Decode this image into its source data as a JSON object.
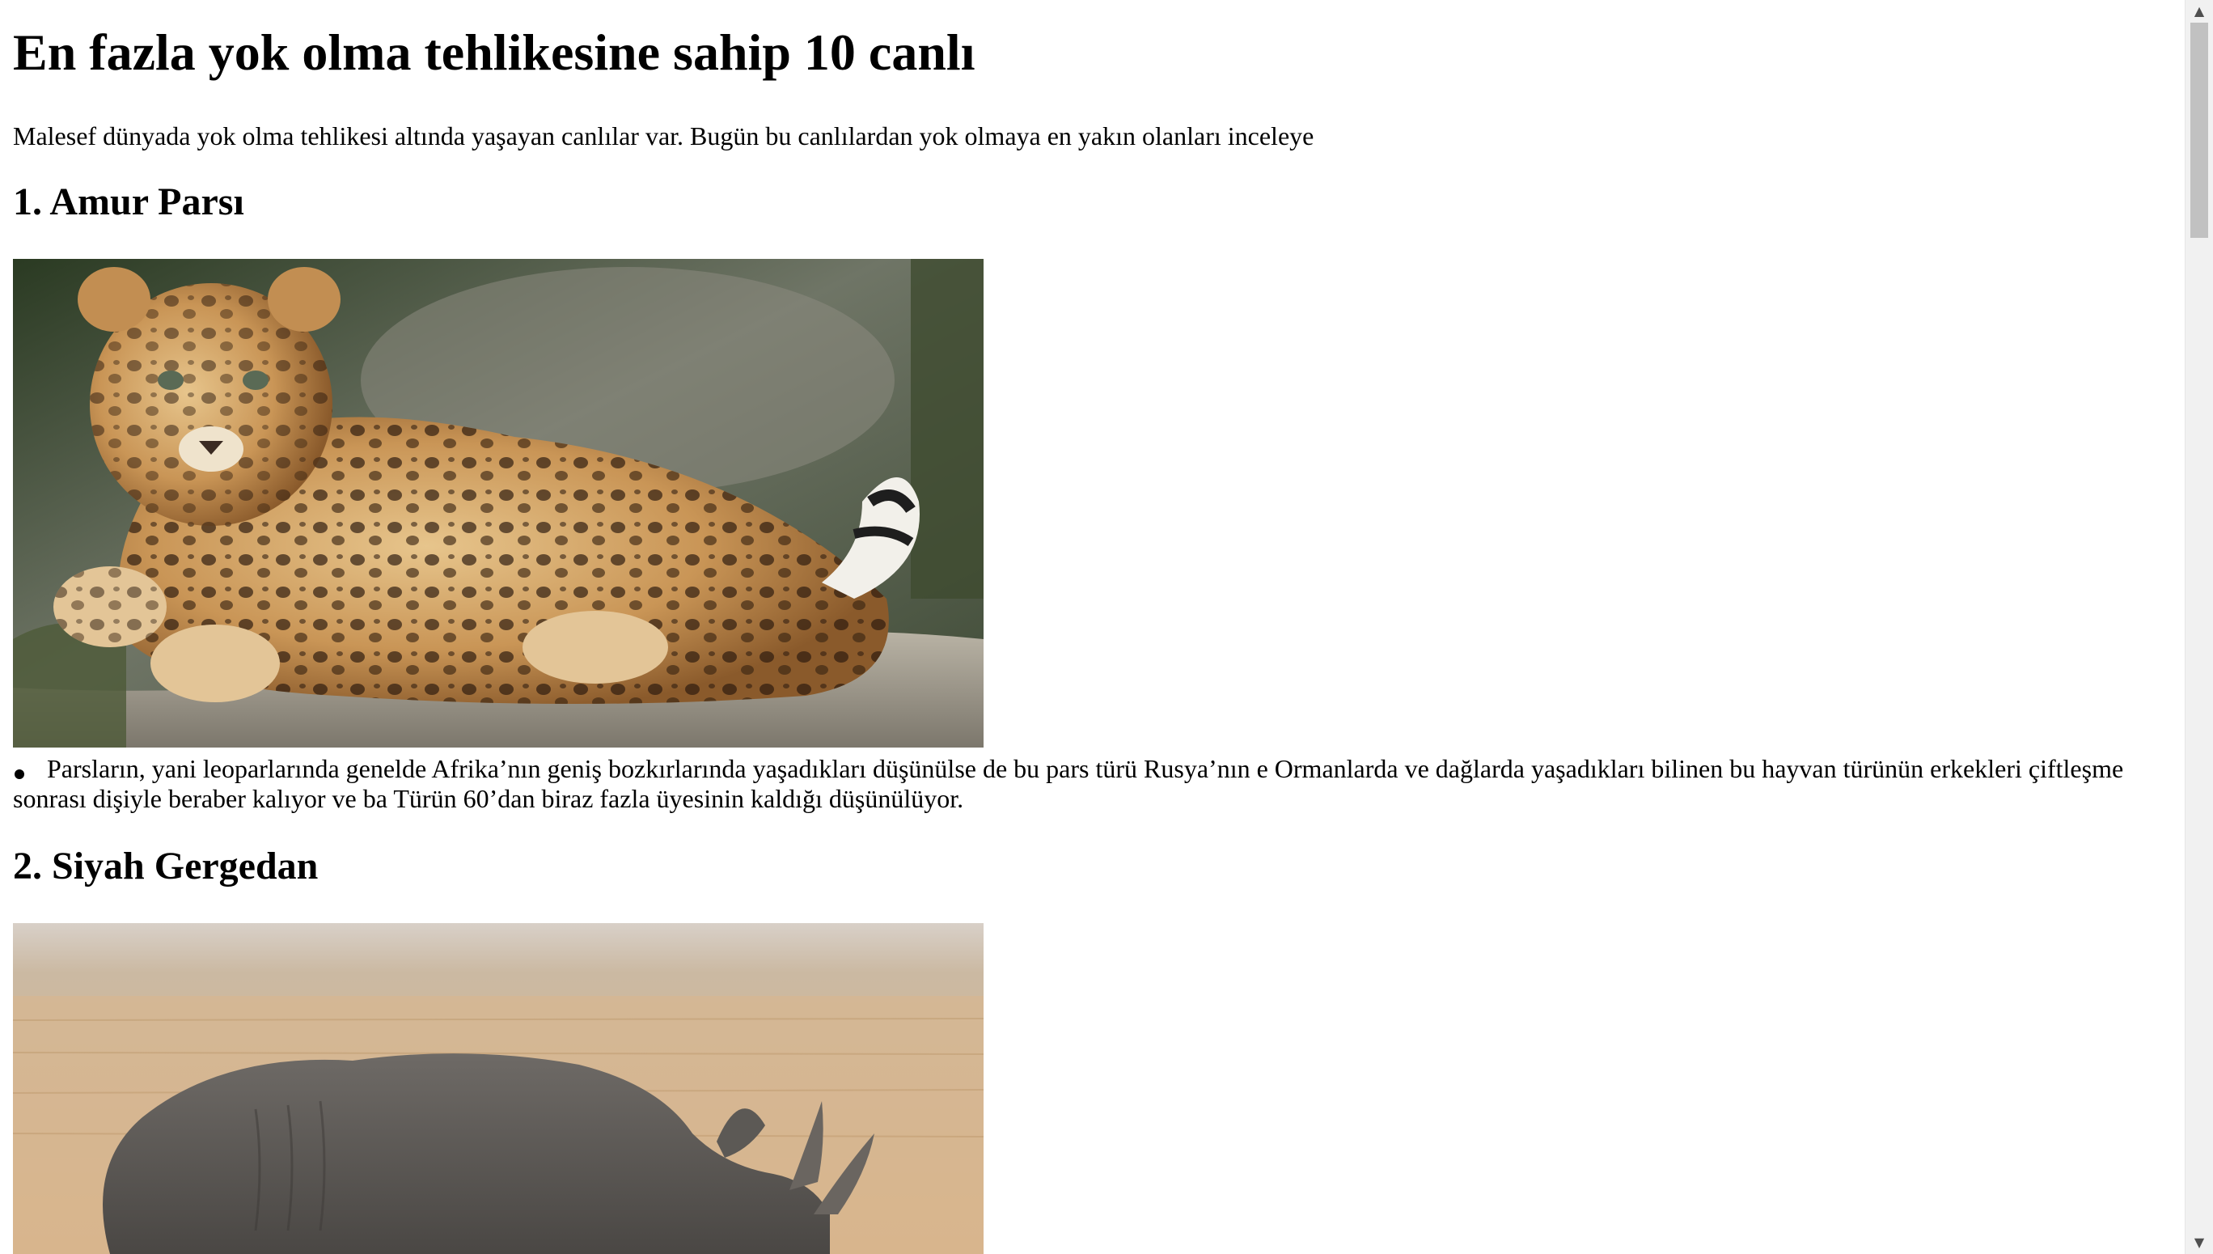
{
  "article": {
    "title": "En fazla yok olma tehlikesine sahip 10 canlı",
    "intro": "Malesef dünyada yok olma tehlikesi altında yaşayan canlılar var. Bugün bu canlılardan yok olmaya en yakın olanları inceleye",
    "sections": [
      {
        "heading": "1. Amur Parsı",
        "image_subject": "amur leopard cub lying on a rock",
        "bullet": "Parsların, yani leoparlarında genelde Afrika’nın geniş bozkırlarında yaşadıkları düşünülse de bu pars türü Rusya’nın e Ormanlarda ve dağlarda yaşadıkları bilinen bu hayvan türünün erkekleri çiftleşme sonrası dişiyle beraber kalıyor ve ba Türün 60’dan biraz fazla üyesinin kaldığı düşünülüyor."
      },
      {
        "heading": "2. Siyah Gergedan",
        "image_subject": "black rhinoceros standing in dry grassland"
      }
    ]
  },
  "scrollbar": {
    "up_icon": "triangle-up-icon",
    "down_icon": "triangle-down-icon",
    "position_fraction": 0.0
  }
}
